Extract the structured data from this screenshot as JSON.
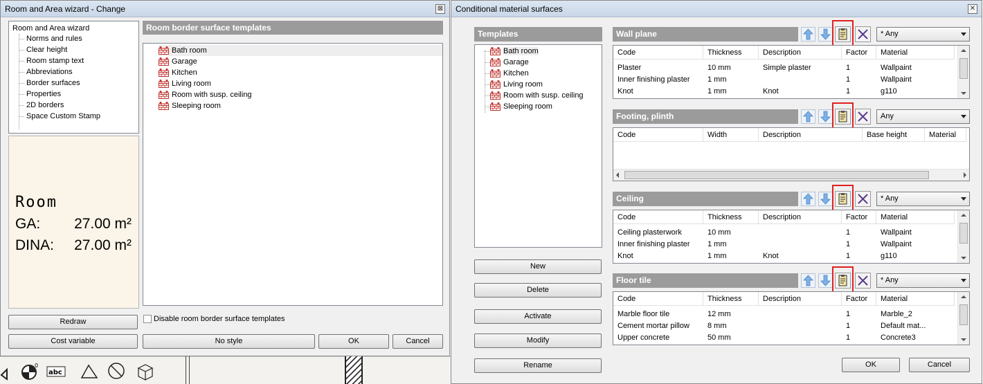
{
  "left_dialog": {
    "title": "Room and Area wizard - Change",
    "close_label": "⊠",
    "tree": {
      "root": "Room and Area wizard",
      "items": [
        "Norms and rules",
        "Clear height",
        "Room stamp text",
        "Abbreviations",
        "Border surfaces",
        "Properties",
        "2D borders",
        "Space Custom Stamp"
      ]
    },
    "preview": {
      "room_text": "Room",
      "ga_label": "GA:",
      "ga_value": "27.00 m²",
      "dina_label": "DINA:",
      "dina_value": "27.00 m²"
    },
    "templates_header": "Room border surface templates",
    "templates": [
      "Bath room",
      "Garage",
      "Kitchen",
      "Living room",
      "Room with susp. ceiling",
      "Sleeping room"
    ],
    "selected_template": "Bath room",
    "disable_checkbox_label": "Disable room border surface templates",
    "buttons": {
      "redraw": "Redraw",
      "cost_variable": "Cost variable",
      "no_style": "No style",
      "ok": "OK",
      "cancel": "Cancel"
    }
  },
  "right_dialog": {
    "title": "Conditional material surfaces",
    "close_label": "✕",
    "templates_header": "Templates",
    "templates": [
      "Bath room",
      "Garage",
      "Kitchen",
      "Living room",
      "Room with susp. ceiling",
      "Sleeping room"
    ],
    "buttons": {
      "new": "New",
      "delete": "Delete",
      "activate": "Activate",
      "modify": "Modify",
      "rename": "Rename",
      "ok": "OK",
      "cancel": "Cancel"
    },
    "sections": {
      "wall": {
        "title": "Wall plane",
        "filter": "* Any",
        "columns": [
          "Code",
          "Thickness",
          "Description",
          "Factor",
          "Material"
        ],
        "rows": [
          [
            "Plaster",
            "10 mm",
            "Simple plaster",
            "1",
            "Wallpaint"
          ],
          [
            "Inner finishing plaster",
            "1 mm",
            "",
            "1",
            "Wallpaint"
          ],
          [
            "Knot",
            "1 mm",
            "Knot",
            "1",
            "g110"
          ]
        ]
      },
      "footing": {
        "title": "Footing, plinth",
        "filter": "Any",
        "columns": [
          "Code",
          "Width",
          "Description",
          "Base height",
          "Material"
        ],
        "rows": []
      },
      "ceiling": {
        "title": "Ceiling",
        "filter": "* Any",
        "columns": [
          "Code",
          "Thickness",
          "Description",
          "Factor",
          "Material"
        ],
        "rows": [
          [
            "Ceiling plasterwork",
            "10 mm",
            "",
            "1",
            "Wallpaint"
          ],
          [
            "Inner finishing plaster",
            "1 mm",
            "",
            "1",
            "Wallpaint"
          ],
          [
            "Knot",
            "1 mm",
            "Knot",
            "1",
            "g110"
          ]
        ]
      },
      "floor": {
        "title": "Floor tile",
        "filter": "* Any",
        "columns": [
          "Code",
          "Thickness",
          "Description",
          "Factor",
          "Material"
        ],
        "rows": [
          [
            "Marble floor tile",
            "12 mm",
            "",
            "1",
            "Marble_2"
          ],
          [
            "Cement mortar pillow",
            "8 mm",
            "",
            "1",
            "Default mat..."
          ],
          [
            "Upper concrete",
            "50 mm",
            "",
            "1",
            "Concrete3"
          ]
        ]
      }
    }
  },
  "colors": {
    "section_bar": "#9b9b9b",
    "highlight_box": "#e02020",
    "template_icon": "#c0302a",
    "preview_bg": "#fbf4e8"
  },
  "icons": {
    "template": "brick-wall-icon",
    "move_up": "arrow-up-icon",
    "move_down": "arrow-down-icon",
    "copy": "clipboard-copy-icon",
    "delete": "delete-x-icon"
  }
}
